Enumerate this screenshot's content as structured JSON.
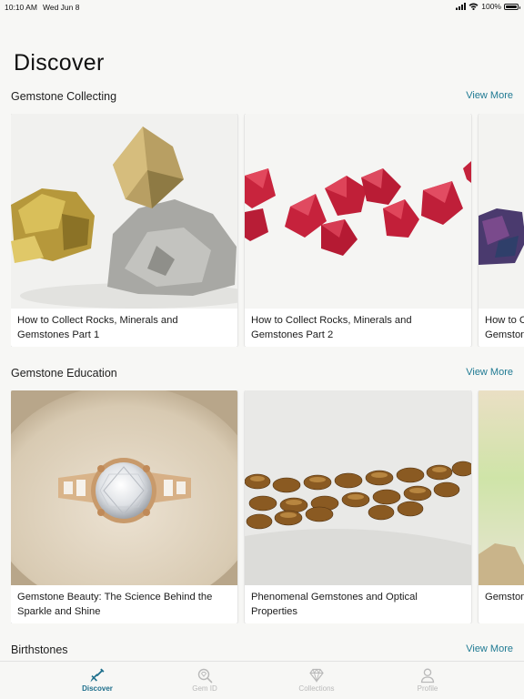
{
  "status_bar": {
    "time": "10:10 AM",
    "date": "Wed Jun 8",
    "battery": "100%"
  },
  "page": {
    "title": "Discover"
  },
  "sections": [
    {
      "title": "Gemstone Collecting",
      "view_more": "View More",
      "cards": [
        {
          "title": "How to Collect Rocks, Minerals and Gemstones Part 1",
          "image": "pyrite-specimen-photo"
        },
        {
          "title": "How to Collect Rocks, Minerals and Gemstones Part 2",
          "image": "red-spinel-crystals-photo"
        },
        {
          "title": "How to Collect Rocks, Minerals and Gemstones",
          "image": "iridescent-rock-photo"
        }
      ]
    },
    {
      "title": "Gemstone Education",
      "view_more": "View More",
      "cards": [
        {
          "title": "Gemstone Beauty: The Science Behind the Sparkle and Shine",
          "image": "diamond-ring-photo"
        },
        {
          "title": "Phenomenal Gemstones and Optical Properties",
          "image": "tigers-eye-beads-photo"
        },
        {
          "title": "Gemstone",
          "image": "green-gradient-photo"
        }
      ]
    },
    {
      "title": "Birthstones",
      "view_more": "View More"
    }
  ],
  "tab_bar": {
    "tabs": [
      {
        "label": "Discover",
        "icon": "shovel-icon",
        "active": true
      },
      {
        "label": "Gem ID",
        "icon": "gem-search-icon",
        "active": false
      },
      {
        "label": "Collections",
        "icon": "diamond-icon",
        "active": false
      },
      {
        "label": "Profile",
        "icon": "person-icon",
        "active": false
      }
    ]
  },
  "colors": {
    "accent": "#1f7a93",
    "active_tab": "#1e6f8c",
    "inactive_tab": "#b9b9b9",
    "background": "#f7f7f5"
  }
}
